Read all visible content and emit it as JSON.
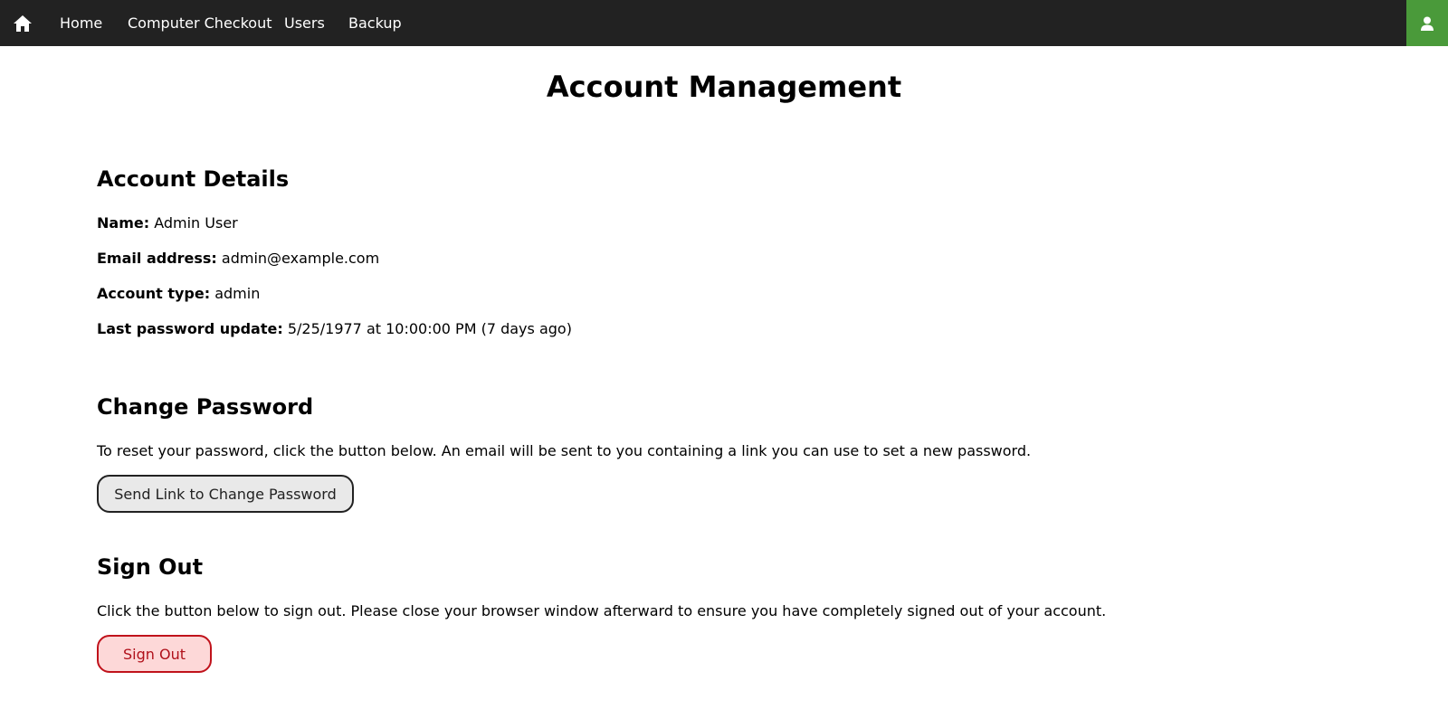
{
  "nav": {
    "home_icon": "home-icon",
    "links": [
      "Home",
      "Computer Checkout",
      "Users",
      "Backup"
    ],
    "account_icon": "user-icon",
    "account_color": "#4a9a3a"
  },
  "page": {
    "title": "Account Management"
  },
  "details": {
    "heading": "Account Details",
    "name_label": "Name:",
    "name_value": "Admin User",
    "email_label": "Email address:",
    "email_value": "admin@example.com",
    "type_label": "Account type:",
    "type_value": "admin",
    "pw_label": "Last password update:",
    "pw_value": "5/25/1977 at 10:00:00 PM (7 days ago)"
  },
  "change_password": {
    "heading": "Change Password",
    "description": "To reset your password, click the button below. An email will be sent to you containing a link you can use to set a new password.",
    "button_label": "Send Link to Change Password"
  },
  "sign_out": {
    "heading": "Sign Out",
    "description": "Click the button below to sign out. Please close your browser window afterward to ensure you have completely signed out of your account.",
    "button_label": "Sign Out",
    "button_color": "#c0121b"
  }
}
